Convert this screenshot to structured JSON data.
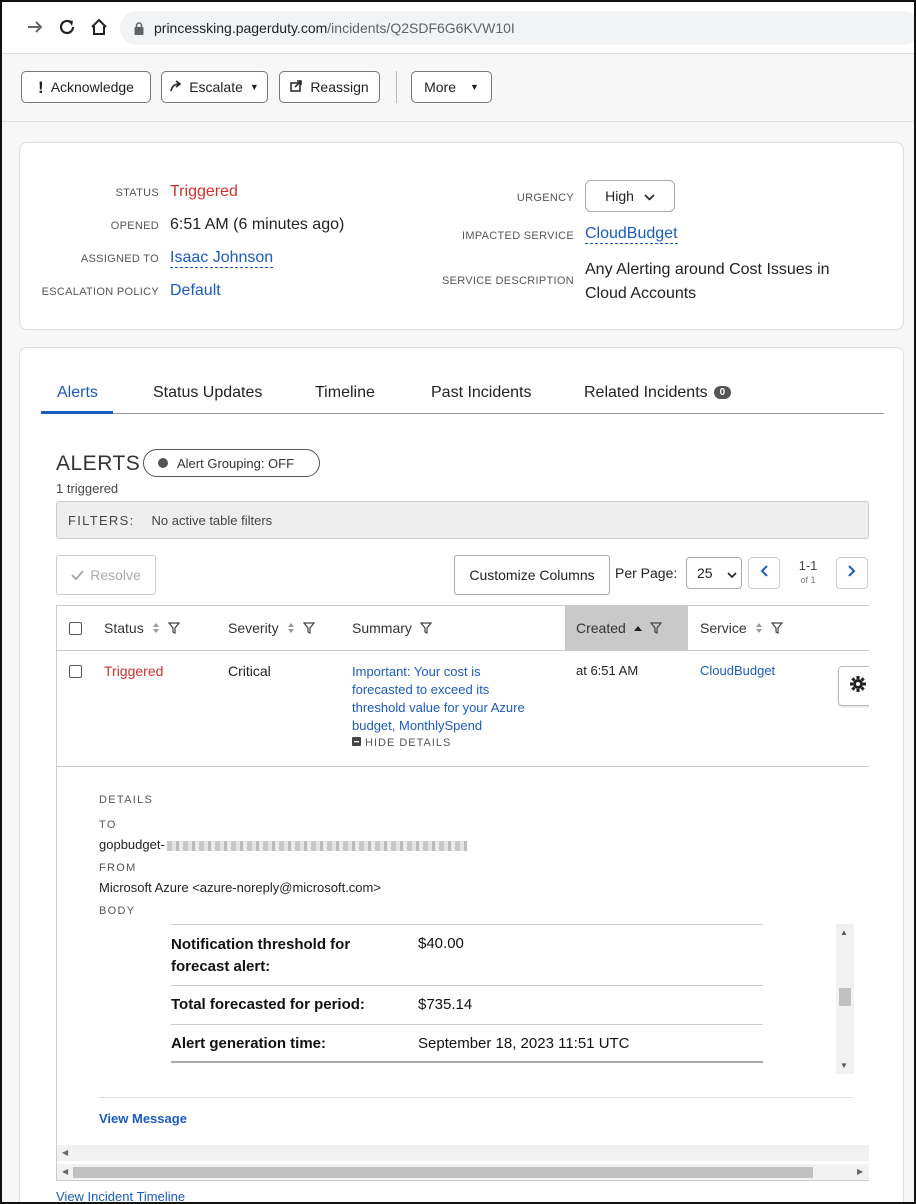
{
  "browser": {
    "url_host": "princessking.pagerduty.com",
    "url_path": "/incidents/Q2SDF6G6KVW10I"
  },
  "toolbar": {
    "acknowledge": "Acknowledge",
    "escalate": "Escalate",
    "reassign": "Reassign",
    "more": "More"
  },
  "incident": {
    "status_label": "STATUS",
    "status": "Triggered",
    "opened_label": "OPENED",
    "opened": "6:51 AM (6 minutes ago)",
    "assigned_label": "ASSIGNED TO",
    "assigned": "Isaac Johnson",
    "escalation_label": "ESCALATION POLICY",
    "escalation": "Default",
    "urgency_label": "URGENCY",
    "urgency": "High",
    "service_label": "IMPACTED SERVICE",
    "service": "CloudBudget",
    "description_label": "SERVICE DESCRIPTION",
    "description_line1": "Any Alerting around Cost Issues in",
    "description_line2": "Cloud Accounts"
  },
  "tabs": [
    {
      "label": "Alerts"
    },
    {
      "label": "Status Updates"
    },
    {
      "label": "Timeline"
    },
    {
      "label": "Past Incidents"
    },
    {
      "label": "Related Incidents",
      "count": "0"
    }
  ],
  "alerts": {
    "heading": "ALERTS",
    "grouping": "Alert Grouping: OFF",
    "triggered_count": "1 triggered",
    "filters_label": "FILTERS:",
    "filters_value": "No active table filters",
    "resolve": "Resolve",
    "customize": "Customize Columns",
    "per_page_label": "Per Page:",
    "per_page": "25",
    "page_range": "1-1",
    "page_of": "of 1"
  },
  "table": {
    "columns": [
      "Status",
      "Severity",
      "Summary",
      "Created",
      "Service"
    ],
    "row": {
      "status": "Triggered",
      "severity": "Critical",
      "summary_lines": [
        "Important: Your cost is",
        "forecasted to exceed its",
        "threshold value for your Azure",
        "budget, MonthlySpend"
      ],
      "hide_details": "HIDE DETAILS",
      "created": "at 6:51 AM",
      "service": "CloudBudget"
    }
  },
  "details": {
    "details_label": "DETAILS",
    "to_label": "TO",
    "to_value": "gopbudget-",
    "from_label": "FROM",
    "from_value": "Microsoft Azure <azure-noreply@microsoft.com>",
    "body_label": "BODY",
    "body_rows": [
      {
        "key_line1": "Notification threshold for",
        "key_line2": "forecast alert:",
        "value": "$40.00"
      },
      {
        "key_line1": "Total forecasted for period:",
        "key_line2": "",
        "value": "$735.14"
      },
      {
        "key_line1": "Alert generation time:",
        "key_line2": "",
        "value": "September 18, 2023 11:51 UTC"
      }
    ],
    "view_message": "View Message"
  },
  "footer": {
    "view_timeline": "View Incident Timeline"
  },
  "colors": {
    "accent": "#1a5bbf",
    "triggered": "#d32f2f"
  }
}
